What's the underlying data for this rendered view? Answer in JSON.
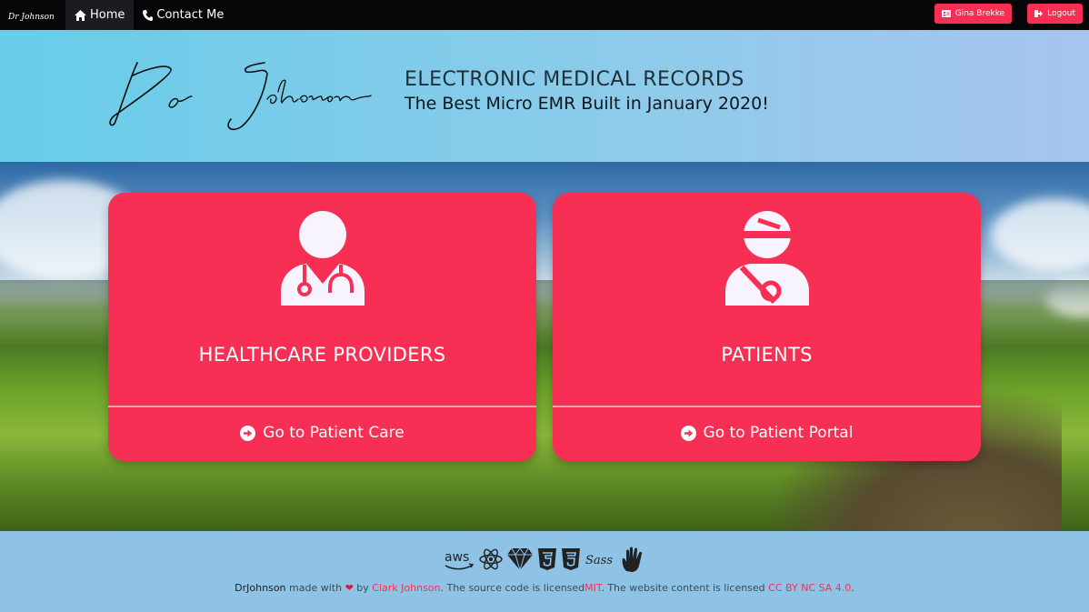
{
  "nav": {
    "brand": "Dr Johnson",
    "items": [
      {
        "label": "Home",
        "icon": "home-icon"
      },
      {
        "label": "Contact Me",
        "icon": "phone-icon"
      }
    ],
    "user_button": "Gina Brekke",
    "logout_button": "Logout"
  },
  "header": {
    "signature": "Dr Johnson",
    "title": "ELECTRONIC MEDICAL RECORDS",
    "subtitle": "The Best Micro EMR Built in January 2020!"
  },
  "cards": [
    {
      "title": "HEALTHCARE PROVIDERS",
      "link": "Go to Patient Care",
      "icon": "doctor-icon"
    },
    {
      "title": "PATIENTS",
      "link": "Go to Patient Portal",
      "icon": "injured-patient-icon"
    }
  ],
  "footer": {
    "tech_icons": [
      "aws-icon",
      "react-icon",
      "diamond-icon",
      "html5-icon",
      "css3-icon",
      "sass-icon",
      "hand-icon"
    ],
    "tech_labels": {
      "aws": "aws",
      "sass": "Sass"
    },
    "site_name": "DrJohnson",
    "made_with": "made with",
    "by": "by",
    "author": "Clark Johnson",
    "source_text": ". The source code is licensed",
    "license_code": "MIT",
    "content_text": ". The website content is licensed",
    "license_content": "CC BY NC SA 4.0",
    "end": ".",
    "colors": {
      "accent": "#f72f55",
      "navbar": "#050608",
      "footer_bg": "#8ec3e6"
    }
  }
}
